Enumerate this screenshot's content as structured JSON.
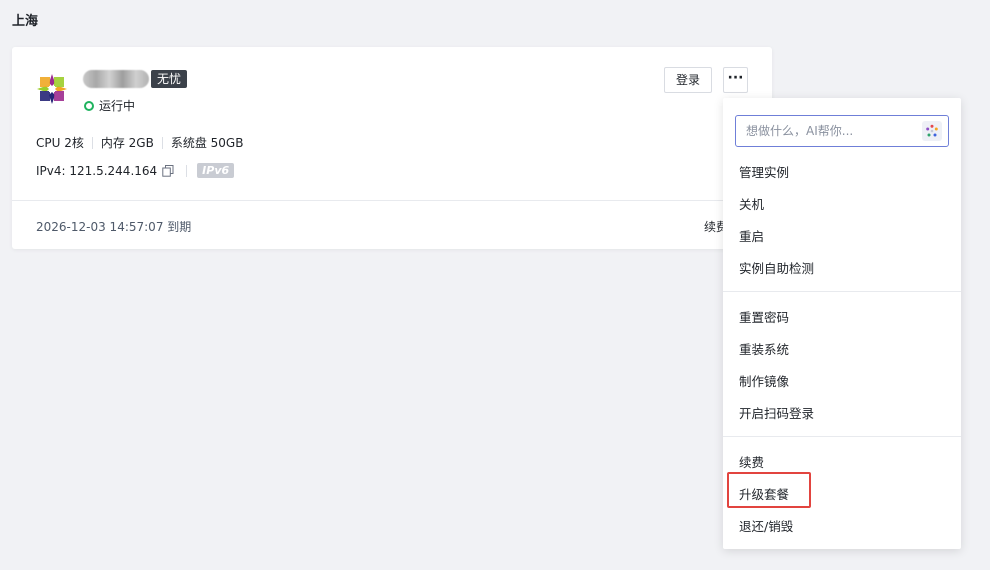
{
  "region": {
    "title": "上海"
  },
  "instance": {
    "tag": "无忧",
    "status": "运行中",
    "status_color": "#1fb35e",
    "specs": [
      "CPU 2核",
      "内存 2GB",
      "系统盘 50GB"
    ],
    "ipv4": "IPv4: 121.5.244.164",
    "ipv6_badge": "IPv6",
    "expire": "2026-12-03 14:57:07 到期",
    "renew_label": "续费",
    "login_label": "登录",
    "more_label": "···"
  },
  "menu": {
    "ai_placeholder": "想做什么，AI帮你...",
    "groups": [
      [
        "管理实例",
        "关机",
        "重启",
        "实例自助检测"
      ],
      [
        "重置密码",
        "重装系统",
        "制作镜像",
        "开启扫码登录"
      ],
      [
        "续费",
        "升级套餐",
        "退还/销毁"
      ]
    ],
    "highlight_color": "#e2443f"
  }
}
